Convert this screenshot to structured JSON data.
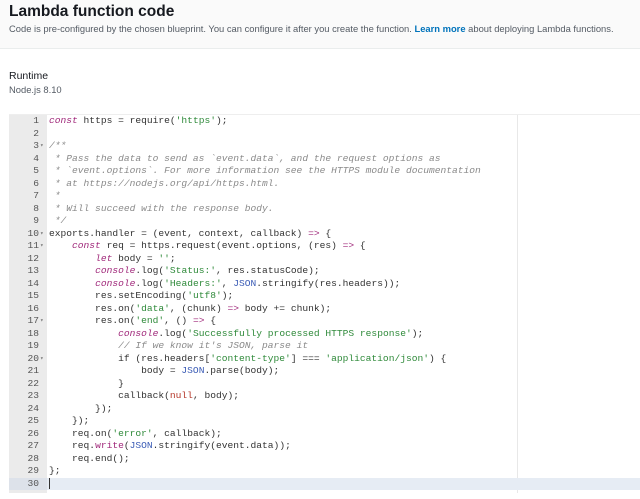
{
  "header": {
    "title": "Lambda function code",
    "subtitle_before": "Code is pre-configured by the chosen blueprint. You can configure it after you create the function. ",
    "learn_more": "Learn more",
    "subtitle_after": " about deploying Lambda functions."
  },
  "runtime": {
    "label": "Runtime",
    "value": "Node.js 8.10"
  },
  "editor": {
    "active_line": 30,
    "fold_lines": [
      3,
      10,
      11,
      17,
      20
    ],
    "lines": [
      [
        [
          "k",
          "const"
        ],
        [
          "t",
          " https = require("
        ],
        [
          "s",
          "'https'"
        ],
        [
          "t",
          ");"
        ]
      ],
      [],
      [
        [
          "c",
          "/**"
        ]
      ],
      [
        [
          "c",
          " * Pass the data to send as `event.data`, and the request options as"
        ]
      ],
      [
        [
          "c",
          " * `event.options`. For more information see the HTTPS module documentation"
        ]
      ],
      [
        [
          "c",
          " * at https://nodejs.org/api/https.html."
        ]
      ],
      [
        [
          "c",
          " *"
        ]
      ],
      [
        [
          "c",
          " * Will succeed with the response body."
        ]
      ],
      [
        [
          "c",
          " */"
        ]
      ],
      [
        [
          "t",
          "exports.handler = (event, context, callback) "
        ],
        [
          "op",
          "=>"
        ],
        [
          "t",
          " {"
        ]
      ],
      [
        [
          "t",
          "    "
        ],
        [
          "k",
          "const"
        ],
        [
          "t",
          " req = https.request(event.options, (res) "
        ],
        [
          "op",
          "=>"
        ],
        [
          "t",
          " {"
        ]
      ],
      [
        [
          "t",
          "        "
        ],
        [
          "k",
          "let"
        ],
        [
          "t",
          " body = "
        ],
        [
          "s",
          "''"
        ],
        [
          "t",
          ";"
        ]
      ],
      [
        [
          "t",
          "        "
        ],
        [
          "k",
          "console"
        ],
        [
          "t",
          ".log("
        ],
        [
          "s",
          "'Status:'"
        ],
        [
          "t",
          ", res.statusCode);"
        ]
      ],
      [
        [
          "t",
          "        "
        ],
        [
          "k",
          "console"
        ],
        [
          "t",
          ".log("
        ],
        [
          "s",
          "'Headers:'"
        ],
        [
          "t",
          ", "
        ],
        [
          "b",
          "JSON"
        ],
        [
          "t",
          ".stringify(res.headers));"
        ]
      ],
      [
        [
          "t",
          "        res.setEncoding("
        ],
        [
          "s",
          "'utf8'"
        ],
        [
          "t",
          ");"
        ]
      ],
      [
        [
          "t",
          "        res.on("
        ],
        [
          "s",
          "'data'"
        ],
        [
          "t",
          ", (chunk) "
        ],
        [
          "op",
          "=>"
        ],
        [
          "t",
          " body += chunk);"
        ]
      ],
      [
        [
          "t",
          "        res.on("
        ],
        [
          "s",
          "'end'"
        ],
        [
          "t",
          ", () "
        ],
        [
          "op",
          "=>"
        ],
        [
          "t",
          " {"
        ]
      ],
      [
        [
          "t",
          "            "
        ],
        [
          "k",
          "console"
        ],
        [
          "t",
          ".log("
        ],
        [
          "s",
          "'Successfully processed HTTPS response'"
        ],
        [
          "t",
          ");"
        ]
      ],
      [
        [
          "t",
          "            "
        ],
        [
          "c",
          "// If we know it's JSON, parse it"
        ]
      ],
      [
        [
          "t",
          "            if (res.headers["
        ],
        [
          "s",
          "'content-type'"
        ],
        [
          "t",
          "] === "
        ],
        [
          "s",
          "'application/json'"
        ],
        [
          "t",
          ") {"
        ]
      ],
      [
        [
          "t",
          "                body = "
        ],
        [
          "b",
          "JSON"
        ],
        [
          "t",
          ".parse(body);"
        ]
      ],
      [
        [
          "t",
          "            }"
        ]
      ],
      [
        [
          "t",
          "            callback("
        ],
        [
          "n",
          "null"
        ],
        [
          "t",
          ", body);"
        ]
      ],
      [
        [
          "t",
          "        });"
        ]
      ],
      [
        [
          "t",
          "    });"
        ]
      ],
      [
        [
          "t",
          "    req.on("
        ],
        [
          "s",
          "'error'"
        ],
        [
          "t",
          ", callback);"
        ]
      ],
      [
        [
          "t",
          "    req."
        ],
        [
          "op",
          "write"
        ],
        [
          "t",
          "("
        ],
        [
          "b",
          "JSON"
        ],
        [
          "t",
          ".stringify(event.data));"
        ]
      ],
      [
        [
          "t",
          "    req.end();"
        ]
      ],
      [
        [
          "t",
          "};"
        ]
      ],
      []
    ]
  }
}
